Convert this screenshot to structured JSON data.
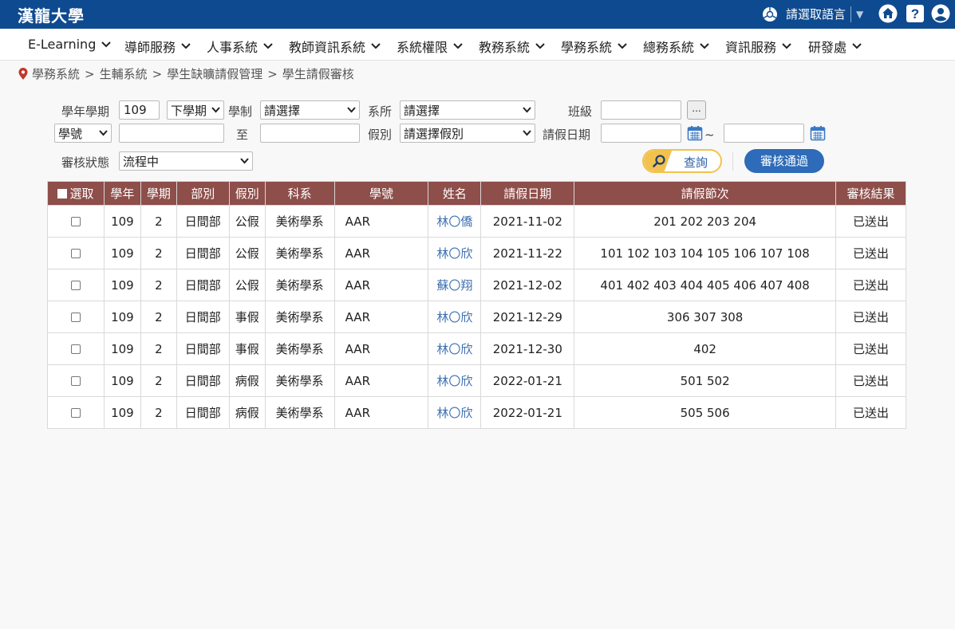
{
  "header": {
    "brand": "漢龍大學",
    "language_label": "請選取語言",
    "icons": [
      "chrome-icon",
      "home-icon",
      "help-icon",
      "user-icon"
    ]
  },
  "nav": [
    {
      "label": "E-Learning"
    },
    {
      "label": "導師服務"
    },
    {
      "label": "人事系統"
    },
    {
      "label": "教師資訊系統"
    },
    {
      "label": "系統權限"
    },
    {
      "label": "教務系統"
    },
    {
      "label": "學務系統"
    },
    {
      "label": "總務系統"
    },
    {
      "label": "資訊服務"
    },
    {
      "label": "研發處"
    }
  ],
  "breadcrumb": [
    "學務系統",
    "生輔系統",
    "學生缺曠請假管理",
    "學生請假審核"
  ],
  "form": {
    "year_label": "學年學期",
    "year_value": "109",
    "term_value": "下學期",
    "system_label": "學制",
    "system_value": "請選擇",
    "dept_label": "系所",
    "dept_value": "請選擇",
    "class_label": "班級",
    "class_value": "",
    "more_button": "...",
    "id_type_value": "學號",
    "id_from_value": "",
    "to_label": "至",
    "id_to_value": "",
    "leave_type_label": "假別",
    "leave_type_value": "請選擇假別",
    "leave_date_label": "請假日期",
    "date_from_value": "",
    "tilde": "~",
    "date_to_value": "",
    "status_label": "審核狀態",
    "status_value": "流程中",
    "query_button": "查詢",
    "approve_button": "審核通過"
  },
  "table": {
    "columns": [
      "選取",
      "學年",
      "學期",
      "部別",
      "假別",
      "科系",
      "學號",
      "姓名",
      "請假日期",
      "請假節次",
      "審核結果"
    ],
    "rows": [
      {
        "year": "109",
        "term": "2",
        "division": "日間部",
        "leave_type": "公假",
        "dept": "美術學系",
        "student_id": "AAR",
        "name": "林〇僑",
        "date": "2021-11-02",
        "periods": "201 202 203 204",
        "result": "已送出"
      },
      {
        "year": "109",
        "term": "2",
        "division": "日間部",
        "leave_type": "公假",
        "dept": "美術學系",
        "student_id": "AAR",
        "name": "林〇欣",
        "date": "2021-11-22",
        "periods": "101 102 103 104 105 106 107 108",
        "result": "已送出"
      },
      {
        "year": "109",
        "term": "2",
        "division": "日間部",
        "leave_type": "公假",
        "dept": "美術學系",
        "student_id": "AAR",
        "name": "蘇〇翔",
        "date": "2021-12-02",
        "periods": "401 402 403 404 405 406 407 408",
        "result": "已送出"
      },
      {
        "year": "109",
        "term": "2",
        "division": "日間部",
        "leave_type": "事假",
        "dept": "美術學系",
        "student_id": "AAR",
        "name": "林〇欣",
        "date": "2021-12-29",
        "periods": "306 307 308",
        "result": "已送出"
      },
      {
        "year": "109",
        "term": "2",
        "division": "日間部",
        "leave_type": "事假",
        "dept": "美術學系",
        "student_id": "AAR",
        "name": "林〇欣",
        "date": "2021-12-30",
        "periods": "402",
        "result": "已送出"
      },
      {
        "year": "109",
        "term": "2",
        "division": "日間部",
        "leave_type": "病假",
        "dept": "美術學系",
        "student_id": "AAR",
        "name": "林〇欣",
        "date": "2022-01-21",
        "periods": "501 502",
        "result": "已送出"
      },
      {
        "year": "109",
        "term": "2",
        "division": "日間部",
        "leave_type": "病假",
        "dept": "美術學系",
        "student_id": "AAR",
        "name": "林〇欣",
        "date": "2022-01-21",
        "periods": "505 506",
        "result": "已送出"
      }
    ]
  },
  "colors": {
    "header_bg": "#0e4a8f",
    "table_header_bg": "#8e4e4a",
    "link": "#3d6fb0",
    "query_accent": "#f2c24e",
    "approve_bg": "#2e6bb8"
  }
}
